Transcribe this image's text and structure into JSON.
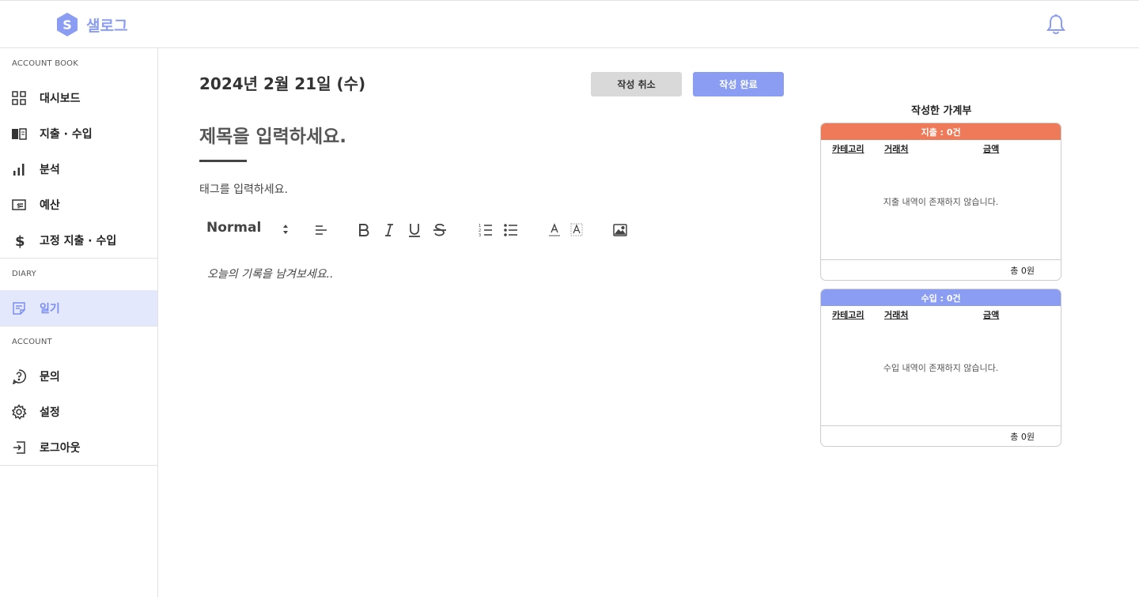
{
  "app": {
    "name": "샐로그",
    "logo_letter": "S",
    "brand_color": "#8a9df3"
  },
  "sidebar": {
    "sections": [
      {
        "label": "ACCOUNT BOOK",
        "items": [
          {
            "label": "대시보드",
            "icon": "grid-icon"
          },
          {
            "label": "지출 · 수입",
            "icon": "book-icon"
          },
          {
            "label": "분석",
            "icon": "bar-chart-icon"
          },
          {
            "label": "예산",
            "icon": "budget-icon"
          },
          {
            "label": "고정 지출 · 수입",
            "icon": "dollar-icon"
          }
        ]
      },
      {
        "label": "DIARY",
        "items": [
          {
            "label": "일기",
            "icon": "note-icon",
            "active": true
          }
        ]
      },
      {
        "label": "ACCOUNT",
        "items": [
          {
            "label": "문의",
            "icon": "help-icon"
          },
          {
            "label": "설정",
            "icon": "gear-icon"
          },
          {
            "label": "로그아웃",
            "icon": "logout-icon"
          }
        ]
      }
    ]
  },
  "editor": {
    "date": "2024년 2월 21일 (수)",
    "cancel_label": "작성 취소",
    "done_label": "작성 완료",
    "title_placeholder": "제목을 입력하세요.",
    "tag_placeholder": "태그를 입력하세요.",
    "format_select": "Normal",
    "body_placeholder": "오늘의 기록을 남겨보세요.."
  },
  "ledger": {
    "title": "작성한 가계부",
    "columns": [
      "카테고리",
      "거래처",
      "금액"
    ],
    "expense": {
      "header": "지출 : 0건",
      "empty": "지출 내역이 존재하지 않습니다.",
      "total": "총 0원",
      "color": "#ee7a5a"
    },
    "income": {
      "header": "수입 : 0건",
      "empty": "수입 내역이 존재하지 않습니다.",
      "total": "총 0원",
      "color": "#8a9df3"
    }
  }
}
